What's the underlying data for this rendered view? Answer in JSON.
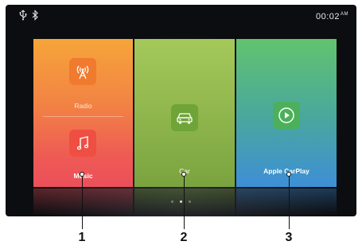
{
  "status": {
    "icons": [
      "usb-icon",
      "bluetooth-icon"
    ],
    "time": "00:02",
    "ampm": "AM"
  },
  "tiles": {
    "radio": {
      "label": "Radio",
      "icon": "radio-antenna-icon"
    },
    "music": {
      "label": "Music",
      "icon": "music-note-icon"
    },
    "car": {
      "label": "Car",
      "icon": "car-icon"
    },
    "carplay": {
      "label": "Apple CarPlay",
      "icon": "play-icon"
    }
  },
  "pager": {
    "pages": 3,
    "active": 2
  },
  "callouts": [
    "1",
    "2",
    "3"
  ]
}
